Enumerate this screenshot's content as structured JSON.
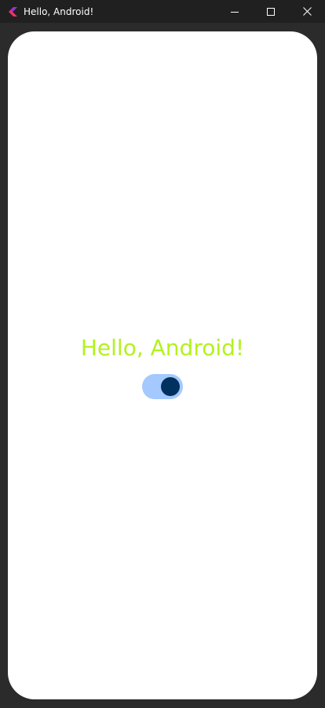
{
  "window": {
    "title": "Hello, Android!",
    "icon": "app-logo-icon",
    "controls": [
      "minimize-icon",
      "maximize-icon",
      "close-icon"
    ]
  },
  "screen": {
    "greeting": "Hello, Android!",
    "toggle": {
      "checked": true
    }
  },
  "colors": {
    "titlebar": "#202020",
    "frame": "#2b2b2b",
    "screen_bg": "#ffffff",
    "greeting_text": "#b2f21e",
    "switch_track": "#a3c9ff",
    "switch_thumb": "#00315f"
  }
}
